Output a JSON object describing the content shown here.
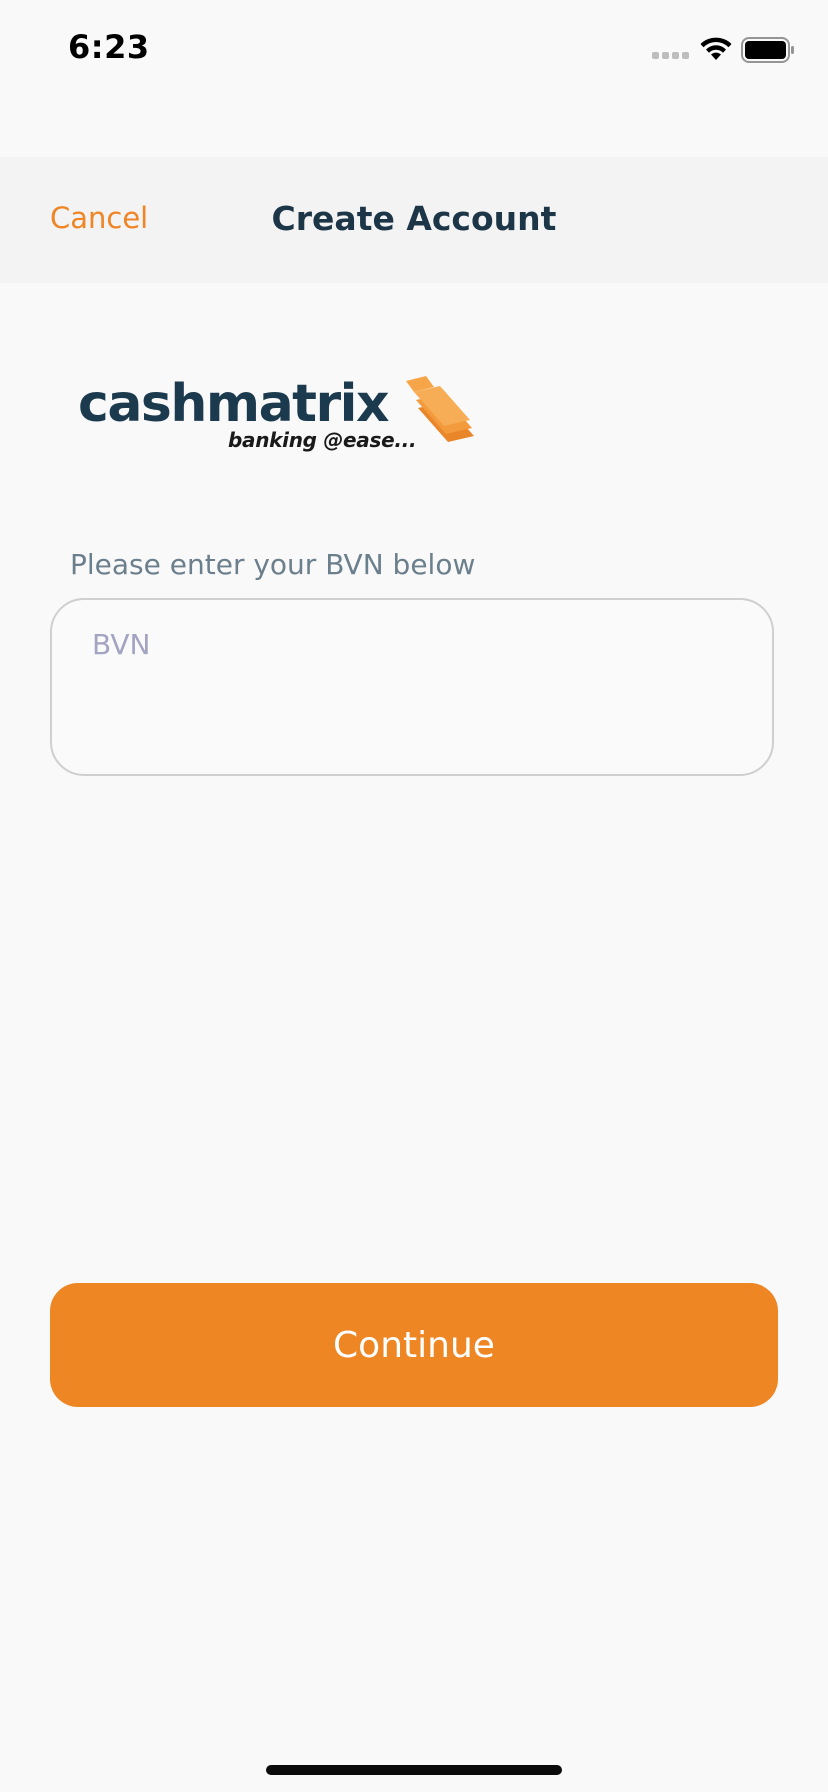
{
  "status_bar": {
    "time": "6:23",
    "signal_icon": "signal-dots-icon",
    "wifi_icon": "wifi-icon",
    "battery_icon": "battery-icon"
  },
  "nav": {
    "cancel_label": "Cancel",
    "title": "Create Account"
  },
  "logo": {
    "wordmark": "cashmatrix",
    "tagline": "banking @ease...",
    "icon": "stacked-layers-icon"
  },
  "form": {
    "label": "Please enter your BVN below",
    "bvn_placeholder": "BVN",
    "bvn_value": ""
  },
  "actions": {
    "continue_label": "Continue"
  },
  "colors": {
    "accent": "#EE8624",
    "title": "#1C3648",
    "background": "#F9F9F9"
  }
}
